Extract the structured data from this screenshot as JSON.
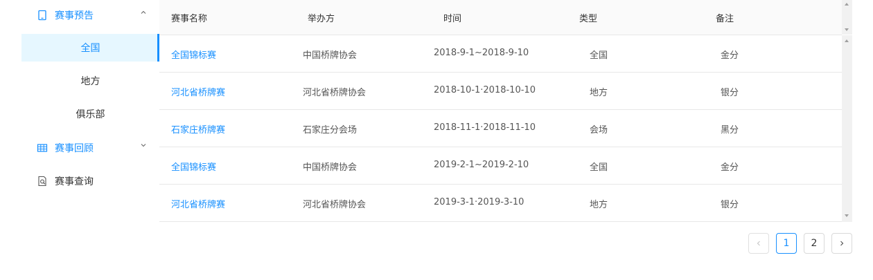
{
  "sidebar": {
    "groups": [
      {
        "label": "赛事预告",
        "icon": "mobile-icon",
        "expanded": true,
        "items": [
          {
            "label": "全国",
            "active": true
          },
          {
            "label": "地方",
            "active": false
          },
          {
            "label": "俱乐部",
            "active": false
          }
        ]
      },
      {
        "label": "赛事回顾",
        "icon": "table-grid-icon",
        "expanded": false
      },
      {
        "label": "赛事查询",
        "icon": "document-search-icon"
      }
    ]
  },
  "table": {
    "columns": [
      "赛事名称",
      "举办方",
      "时间",
      "类型",
      "备注"
    ],
    "rows": [
      [
        "全国锦标赛",
        "中国桥牌协会",
        "2018-9-1~2018-9-10",
        "全国",
        "金分"
      ],
      [
        "河北省桥牌赛",
        "河北省桥牌协会",
        "2018-10-1·2018-10-10",
        "地方",
        "银分"
      ],
      [
        "石家庄桥牌赛",
        "石家庄分会场",
        "2018-11-1·2018-11-10",
        "会场",
        "黑分"
      ],
      [
        "全国锦标赛",
        "中国桥牌协会",
        "2019-2-1~2019-2-10",
        "全国",
        "金分"
      ],
      [
        "河北省桥牌赛",
        "河北省桥牌协会",
        "2019-3-1·2019-3-10",
        "地方",
        "银分"
      ]
    ]
  },
  "pagination": {
    "prev_icon": "chevron-left-icon",
    "next_icon": "chevron-right-icon",
    "pages": [
      "1",
      "2"
    ],
    "current": "1"
  },
  "colors": {
    "accent": "#1890ff",
    "active_bg": "#e6f7ff",
    "border": "#e8e8e8",
    "header_bg": "#fafafa"
  }
}
